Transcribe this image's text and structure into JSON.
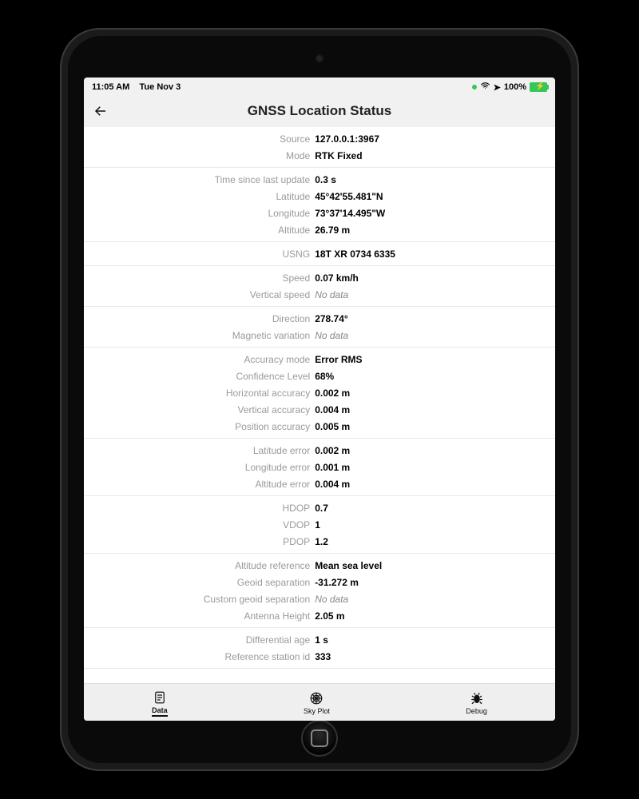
{
  "statusbar": {
    "time": "11:05 AM",
    "date": "Tue Nov 3",
    "battery_pct": "100%"
  },
  "header": {
    "title": "GNSS Location Status"
  },
  "groups": [
    [
      {
        "label": "Source",
        "value": "127.0.0.1:3967"
      },
      {
        "label": "Mode",
        "value": "RTK Fixed"
      }
    ],
    [
      {
        "label": "Time since last update",
        "value": "0.3 s"
      },
      {
        "label": "Latitude",
        "value": "45°42'55.481\"N"
      },
      {
        "label": "Longitude",
        "value": "73°37'14.495\"W"
      },
      {
        "label": "Altitude",
        "value": "26.79 m"
      }
    ],
    [
      {
        "label": "USNG",
        "value": "18T XR 0734 6335"
      }
    ],
    [
      {
        "label": "Speed",
        "value": "0.07 km/h"
      },
      {
        "label": "Vertical speed",
        "value": "No data",
        "nodata": true
      }
    ],
    [
      {
        "label": "Direction",
        "value": "278.74°"
      },
      {
        "label": "Magnetic variation",
        "value": "No data",
        "nodata": true
      }
    ],
    [
      {
        "label": "Accuracy mode",
        "value": "Error RMS"
      },
      {
        "label": "Confidence Level",
        "value": "68%"
      },
      {
        "label": "Horizontal accuracy",
        "value": "0.002 m"
      },
      {
        "label": "Vertical accuracy",
        "value": "0.004 m"
      },
      {
        "label": "Position accuracy",
        "value": "0.005 m"
      }
    ],
    [
      {
        "label": "Latitude error",
        "value": "0.002 m"
      },
      {
        "label": "Longitude error",
        "value": "0.001 m"
      },
      {
        "label": "Altitude error",
        "value": "0.004 m"
      }
    ],
    [
      {
        "label": "HDOP",
        "value": "0.7"
      },
      {
        "label": "VDOP",
        "value": "1"
      },
      {
        "label": "PDOP",
        "value": "1.2"
      }
    ],
    [
      {
        "label": "Altitude reference",
        "value": "Mean sea level"
      },
      {
        "label": "Geoid separation",
        "value": "-31.272 m"
      },
      {
        "label": "Custom geoid separation",
        "value": "No data",
        "nodata": true
      },
      {
        "label": "Antenna Height",
        "value": "2.05 m"
      }
    ],
    [
      {
        "label": "Differential age",
        "value": "1 s"
      },
      {
        "label": "Reference station id",
        "value": "333"
      }
    ]
  ],
  "tabs": {
    "data": "Data",
    "skyplot": "Sky Plot",
    "debug": "Debug"
  }
}
